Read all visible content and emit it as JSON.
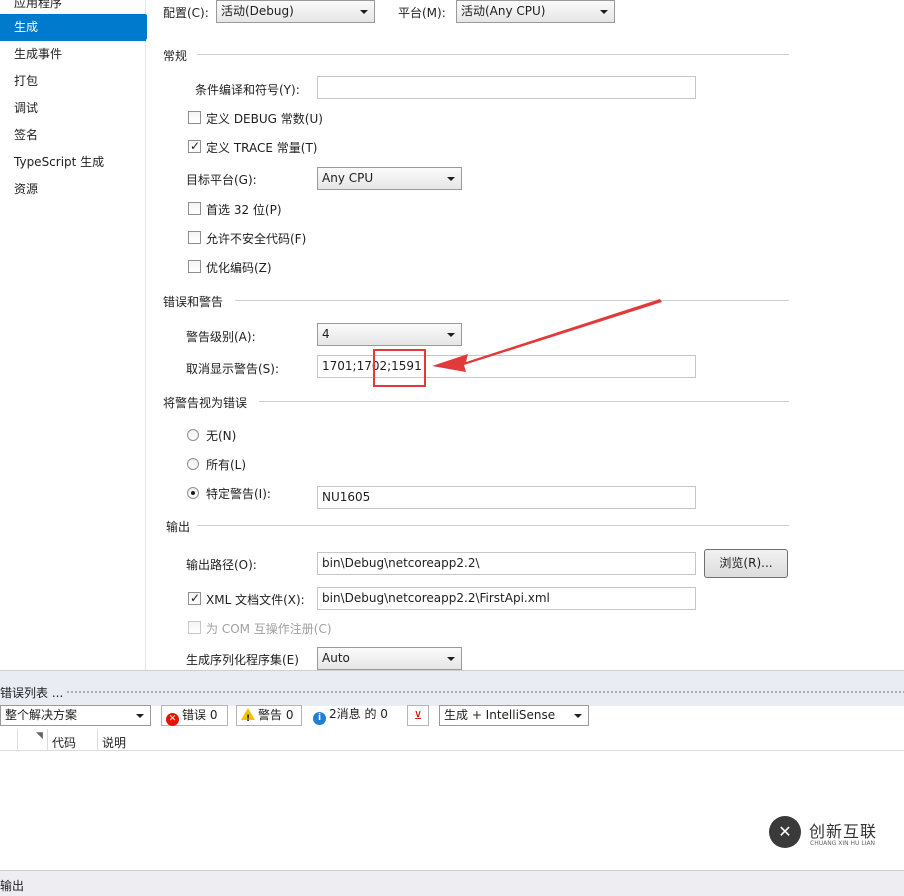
{
  "sidebar": {
    "items": [
      {
        "label": "应用程序"
      },
      {
        "label": "生成"
      },
      {
        "label": "生成事件"
      },
      {
        "label": "打包"
      },
      {
        "label": "调试"
      },
      {
        "label": "签名"
      },
      {
        "label": "TypeScript 生成"
      },
      {
        "label": "资源"
      }
    ],
    "active": "生成"
  },
  "config": {
    "config_label": "配置(C):",
    "config_value": "活动(Debug)",
    "platform_label": "平台(M):",
    "platform_value": "活动(Any CPU)"
  },
  "general": {
    "title": "常规",
    "symbols_label": "条件编译和符号(Y):",
    "symbols_value": "",
    "define_debug": {
      "label": "定义 DEBUG 常数(U)",
      "checked": false
    },
    "define_trace": {
      "label": "定义 TRACE 常量(T)",
      "checked": true
    },
    "target_label": "目标平台(G):",
    "target_value": "Any CPU",
    "prefer32": {
      "label": "首选 32 位(P)",
      "checked": false
    },
    "unsafe": {
      "label": "允许不安全代码(F)",
      "checked": false
    },
    "optimize": {
      "label": "优化编码(Z)",
      "checked": false
    }
  },
  "warnings": {
    "title": "错误和警告",
    "level_label": "警告级别(A):",
    "level_value": "4",
    "suppress_label": "取消显示警告(S):",
    "suppress_value": "1701;1702;1591"
  },
  "treat_as_errors": {
    "title": "将警告视为错误",
    "none_label": "无(N)",
    "all_label": "所有(L)",
    "specific_label": "特定警告(I):",
    "selected": "specific",
    "specific_value": "NU1605"
  },
  "output": {
    "title": "输出",
    "path_label": "输出路径(O):",
    "path_value": "bin\\Debug\\netcoreapp2.2\\",
    "browse_label": "浏览(R)...",
    "xml_doc": {
      "label": "XML 文档文件(X):",
      "checked": true
    },
    "xml_value": "bin\\Debug\\netcoreapp2.2\\FirstApi.xml",
    "com_interop": {
      "label": "为 COM 互操作注册(C)",
      "checked": false
    },
    "serialization_label": "生成序列化程序集(E)",
    "serialization_value": "Auto"
  },
  "error_list": {
    "title": "错误列表 ...",
    "scope_value": "整个解决方案",
    "errors_label": "错误 0",
    "warnings_label": "警告 0",
    "messages_label": "2消息 的 0",
    "source_value": "生成 + IntelliSense",
    "columns": {
      "code": "代码",
      "desc": "说明"
    }
  },
  "statusbar": {
    "label": "输出"
  },
  "watermark": {
    "text": "创新互联",
    "subtext": "CHUANG XIN HU LIAN"
  },
  "colors": {
    "accent": "#007acc",
    "annotation": "#e03a3a"
  }
}
